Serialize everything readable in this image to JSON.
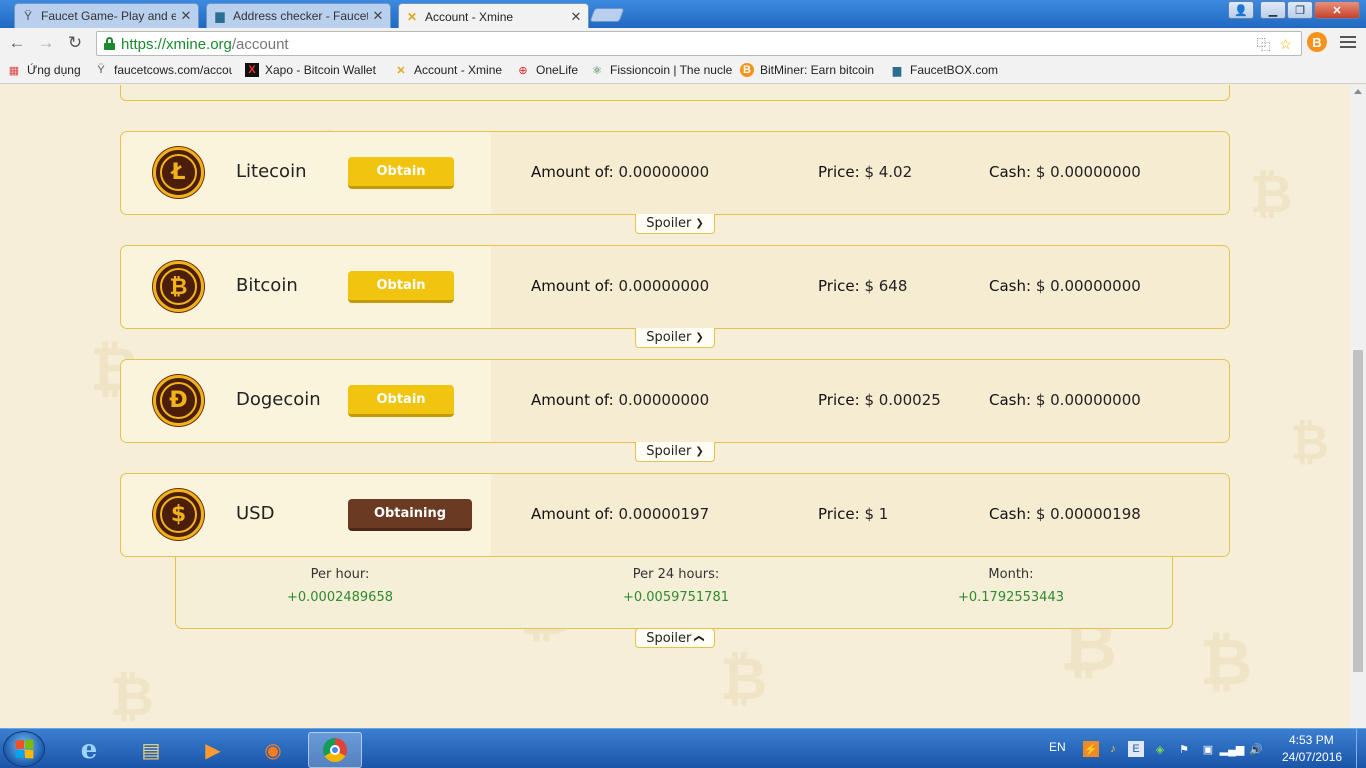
{
  "browser": {
    "tabs": [
      {
        "label": "Faucet Game- Play and ea",
        "icon": "faucetcows-icon",
        "active": false
      },
      {
        "label": "Address checker - FaucetB",
        "icon": "faucetbox-icon",
        "active": false
      },
      {
        "label": "Account - Xmine",
        "icon": "xmine-icon",
        "active": true
      }
    ],
    "url_scheme": "https://xmine.org",
    "url_path": "/account",
    "bookmarks": [
      {
        "label": "Ứng dụng",
        "icon": "apps-grid-icon"
      },
      {
        "label": "faucetcows.com/accou",
        "icon": "faucetcows-icon"
      },
      {
        "label": "Xapo - Bitcoin Wallet",
        "icon": "xapo-icon"
      },
      {
        "label": "Account - Xmine",
        "icon": "xmine-icon"
      },
      {
        "label": "OneLife",
        "icon": "onelife-icon"
      },
      {
        "label": "Fissioncoin | The nucle",
        "icon": "fissioncoin-icon"
      },
      {
        "label": "BitMiner: Earn bitcoin",
        "icon": "bitcoin-icon"
      },
      {
        "label": "FaucetBOX.com",
        "icon": "faucetbox-icon"
      }
    ]
  },
  "coins": [
    {
      "name": "Litecoin",
      "symbol": "Ł",
      "button": "Obtain",
      "obtaining": false,
      "amount_label": "Amount of:",
      "amount": "0.00000000",
      "price_label": "Price:",
      "price": "$ 4.02",
      "cash_label": "Cash:",
      "cash": "$ 0.00000000"
    },
    {
      "name": "Bitcoin",
      "symbol": "₿",
      "button": "Obtain",
      "obtaining": false,
      "amount_label": "Amount of:",
      "amount": "0.00000000",
      "price_label": "Price:",
      "price": "$ 648",
      "cash_label": "Cash:",
      "cash": "$ 0.00000000"
    },
    {
      "name": "Dogecoin",
      "symbol": "Đ",
      "button": "Obtain",
      "obtaining": false,
      "amount_label": "Amount of:",
      "amount": "0.00000000",
      "price_label": "Price:",
      "price": "$ 0.00025",
      "cash_label": "Cash:",
      "cash": "$ 0.00000000"
    },
    {
      "name": "USD",
      "symbol": "$",
      "button": "Obtaining",
      "obtaining": true,
      "amount_label": "Amount of:",
      "amount": "0.00000197",
      "price_label": "Price:",
      "price": "$ 1",
      "cash_label": "Cash:",
      "cash": "$ 0.00000198"
    }
  ],
  "spoiler_label": "Spoiler",
  "earnings": [
    {
      "label": "Per hour:",
      "value": "+0.0002489658"
    },
    {
      "label": "Per 24 hours:",
      "value": "+0.0059751781"
    },
    {
      "label": "Month:",
      "value": "+0.1792553443"
    }
  ],
  "taskbar": {
    "language": "EN",
    "time": "4:53 PM",
    "date": "24/07/2016"
  },
  "colors": {
    "accent_gold": "#f1c40f",
    "obtaining_brown": "#6b3a22",
    "earn_green": "#2e8b2e",
    "page_bg": "#f6eed8"
  }
}
